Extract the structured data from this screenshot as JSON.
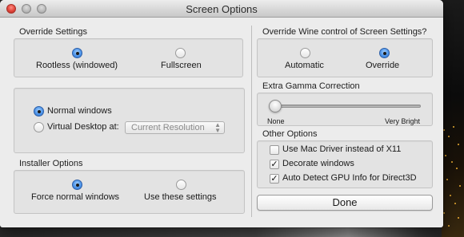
{
  "window": {
    "title": "Screen Options"
  },
  "override_settings": {
    "label": "Override Settings",
    "options": [
      {
        "label": "Rootless (windowed)",
        "selected": true
      },
      {
        "label": "Fullscreen",
        "selected": false
      }
    ]
  },
  "window_mode": {
    "options": [
      {
        "label": "Normal windows",
        "selected": true
      },
      {
        "label": "Virtual Desktop at:",
        "selected": false
      }
    ],
    "resolution_value": "Current Resolution"
  },
  "installer_options": {
    "label": "Installer Options",
    "options": [
      {
        "label": "Force normal windows",
        "selected": true
      },
      {
        "label": "Use these settings",
        "selected": false
      }
    ]
  },
  "wine_control": {
    "label": "Override Wine control of Screen Settings?",
    "options": [
      {
        "label": "Automatic",
        "selected": false
      },
      {
        "label": "Override",
        "selected": true
      }
    ]
  },
  "gamma": {
    "label": "Extra Gamma Correction",
    "min_label": "None",
    "max_label": "Very Bright",
    "value": 0
  },
  "other_options": {
    "label": "Other Options",
    "checkboxes": [
      {
        "label": "Use Mac Driver instead of X11",
        "checked": false
      },
      {
        "label": "Decorate windows",
        "checked": true
      },
      {
        "label": "Auto Detect GPU Info for Direct3D",
        "checked": true
      }
    ]
  },
  "done_label": "Done",
  "colors": {
    "accent": "#4f95e8",
    "window_bg": "#ececec"
  },
  "icons": {
    "check": "✓",
    "popup_arrows": "up-down-chevron-icon"
  }
}
